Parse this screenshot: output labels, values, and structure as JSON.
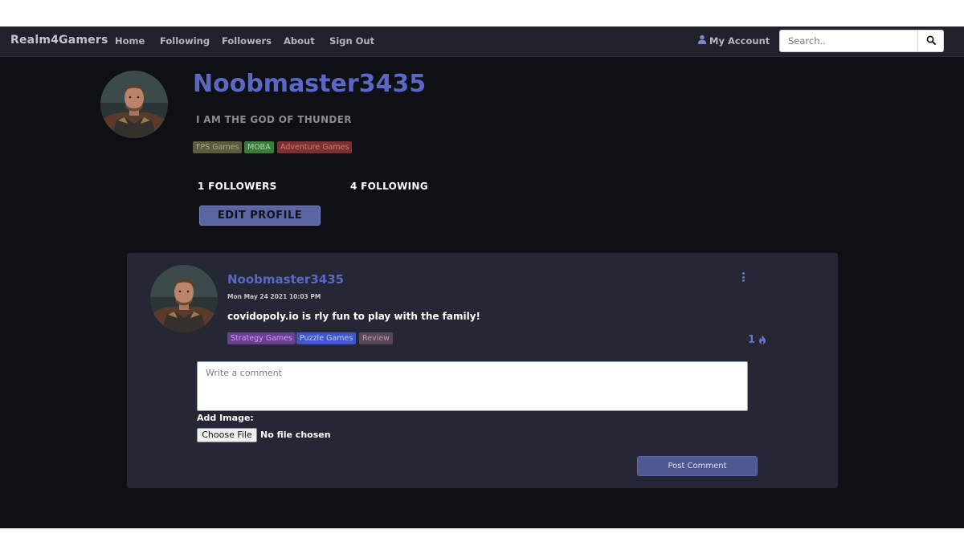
{
  "navbar": {
    "brand": "Realm4Gamers",
    "links": [
      "Home",
      "Following",
      "Followers",
      "About",
      "Sign Out"
    ],
    "account_label": "My Account",
    "search_placeholder": "Search..",
    "icons": {
      "account": "user-icon",
      "search": "search-icon"
    }
  },
  "profile": {
    "username": "Noobmaster3435",
    "bio": "I AM THE GOD OF THUNDER",
    "tags": [
      {
        "label": "FPS Games",
        "bg": "#5b5a3c",
        "fg": "#a7a58a"
      },
      {
        "label": "MOBA",
        "bg": "#3b7c3c",
        "fg": "#a6d3a6"
      },
      {
        "label": "Adventure Games",
        "bg": "#7e3030",
        "fg": "#c77a7a"
      }
    ],
    "followers": "1 FOLLOWERS",
    "following": "4 FOLLOWING",
    "edit_button": "EDIT PROFILE"
  },
  "post": {
    "author": "Noobmaster3435",
    "date": "Mon May 24 2021 10:03 PM",
    "text": "covidopoly.io is rly fun to play with the family!",
    "tags": [
      {
        "label": "Strategy Games",
        "bg": "#6a3f93",
        "fg": "#c4a5e6"
      },
      {
        "label": "Puzzle Games",
        "bg": "#3f56c9",
        "fg": "#c5cdf4"
      },
      {
        "label": "Review",
        "bg": "#5a4656",
        "fg": "#b29bac"
      }
    ],
    "like_count": "1",
    "icons": {
      "menu": "kebab-menu-icon",
      "like": "flame-icon"
    }
  },
  "comment_form": {
    "placeholder": "Write a comment",
    "add_image_label": "Add Image:",
    "file_button": "Choose File",
    "file_status": "No file chosen",
    "submit_label": "Post Comment"
  },
  "colors": {
    "accent": "#5a67c4",
    "background": "#0f1016",
    "card": "#262734",
    "navbar": "#20212a"
  }
}
